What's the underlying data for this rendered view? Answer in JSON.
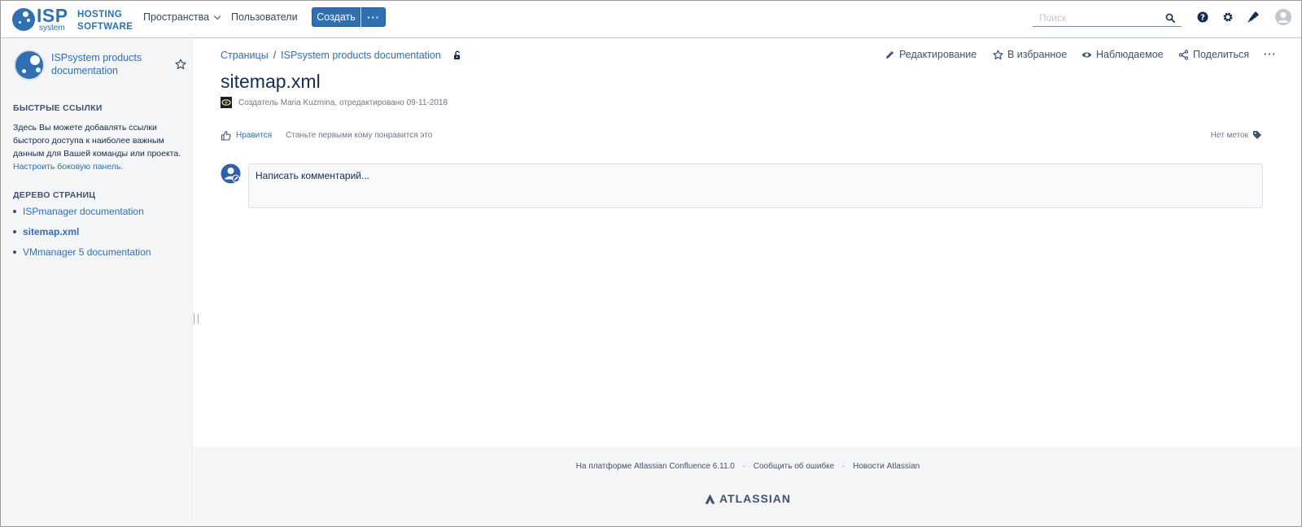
{
  "header": {
    "logo_isp": "ISP",
    "logo_system": "system",
    "brand_line1": "HOSTING",
    "brand_line2": "SOFTWARE",
    "nav_spaces": "Пространства",
    "nav_users": "Пользователи",
    "create_label": "Создать",
    "more_label": "···",
    "search_placeholder": "Поиск"
  },
  "sidebar": {
    "space_title": "ISPsystem products documentation",
    "quick_links_heading": "БЫСТРЫЕ ССЫЛКИ",
    "quick_links_text": "Здесь Вы можете добавлять ссылки быстрого доступа к наиболее важным данным для Вашей команды или проекта.",
    "configure_link": "Настроить боковую панель.",
    "tree_heading": "ДЕРЕВО СТРАНИЦ",
    "tree": [
      {
        "label": "ISPmanager documentation"
      },
      {
        "label": "sitemap.xml",
        "current": true
      },
      {
        "label": "VMmanager 5 documentation"
      }
    ]
  },
  "breadcrumb": {
    "pages": "Страницы",
    "separator": "/",
    "space": "ISPsystem products documentation"
  },
  "actions": {
    "edit": "Редактирование",
    "favorite": "В избранное",
    "watch": "Наблюдаемое",
    "share": "Поделиться",
    "more": "···"
  },
  "page": {
    "title": "sitemap.xml",
    "byline": "Создатель Maria Kuzmina, отредактировано 09-11-2018",
    "like_label": "Нравится",
    "like_hint": "Станьте первыми кому понравится это",
    "no_labels": "Нет меток",
    "comment_placeholder": "Написать комментарий..."
  },
  "footer": {
    "powered": "На платформе Atlassian Confluence 6.11.0",
    "report": "Сообщить об ошибке",
    "news": "Новости Atlassian",
    "dot": "·",
    "atlassian_logo": "ATLASSIAN"
  },
  "colors": {
    "brand": "#2f6fb4",
    "text": "#172b4d",
    "sidebar_bg": "#f4f5f7"
  }
}
